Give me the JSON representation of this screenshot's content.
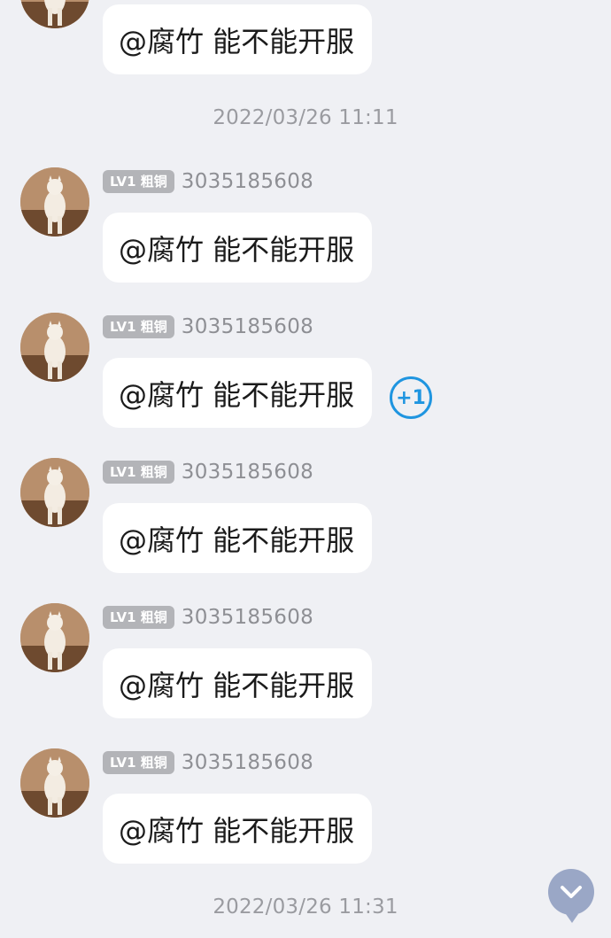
{
  "messages_top": {
    "partial_message": {
      "text": "@腐竹 能不能开服"
    }
  },
  "timestamps": [
    "2022/03/26 11:11",
    "2022/03/26 11:31"
  ],
  "messages": [
    {
      "level": "LV1 粗铜",
      "sender": "3035185608",
      "text": "@腐竹 能不能开服",
      "reaction": ""
    },
    {
      "level": "LV1 粗铜",
      "sender": "3035185608",
      "text": "@腐竹 能不能开服",
      "reaction": "+1"
    },
    {
      "level": "LV1 粗铜",
      "sender": "3035185608",
      "text": "@腐竹 能不能开服",
      "reaction": ""
    },
    {
      "level": "LV1 粗铜",
      "sender": "3035185608",
      "text": "@腐竹 能不能开服",
      "reaction": ""
    },
    {
      "level": "LV1 粗铜",
      "sender": "3035185608",
      "text": "@腐竹 能不能开服",
      "reaction": ""
    }
  ],
  "icons": {
    "avatar": "cat-avatar-icon",
    "scroll_down": "chevron-down-icon"
  },
  "colors": {
    "background": "#eff0f4",
    "bubble": "#ffffff",
    "badge": "#b3b4b8",
    "reaction_accent": "#1f95e0",
    "scroll_button": "#9aa7c6"
  }
}
